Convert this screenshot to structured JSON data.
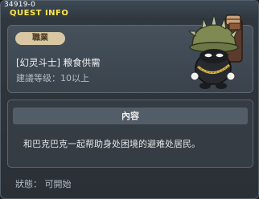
{
  "window": {
    "quest_id": "34919-0",
    "title": "QUEST INFO"
  },
  "quest": {
    "category_label": "職業",
    "name": "[幻灵斗士] 粮食供需",
    "recommended_level": "建議等级：10以上"
  },
  "npc": {
    "icon": "helmeted-npc-portrait"
  },
  "content": {
    "header": "內容",
    "description": "和巴克巴克一起帮助身处困境的避难处居民。"
  },
  "status": {
    "text": "狀態： 可開始"
  },
  "colors": {
    "title": "#ffe74a",
    "badge_bg": "#d9c7a4",
    "window_bg": "#2f353b"
  }
}
